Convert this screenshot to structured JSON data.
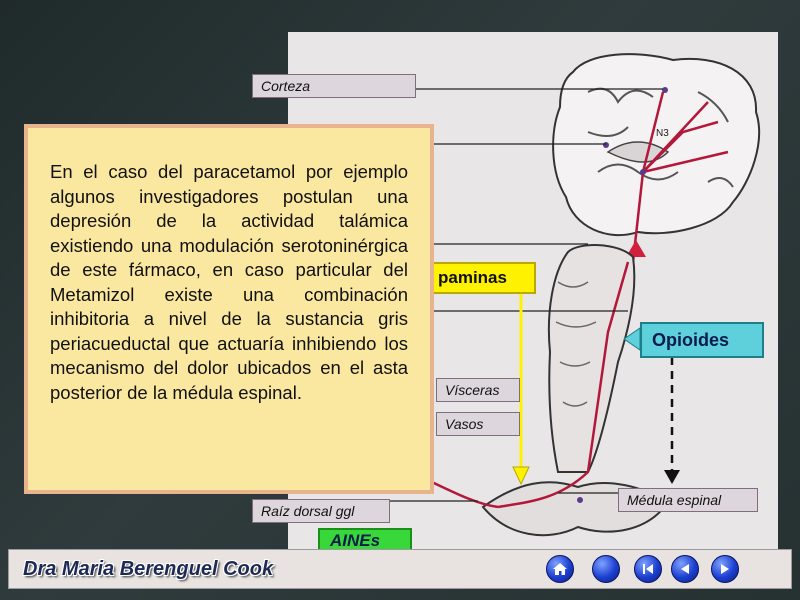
{
  "slide": {
    "paragraph": "En el caso del paracetamol por ejemplo algunos investigadores postulan una depresión de la actividad talámica existiendo una modulación serotoninérgica  de este fármaco, en caso particular del Metamizol existe una combinación inhibitoria a nivel de la sustancia gris periacueductal que actuaría inhibiendo los mecanismo del dolor ubicados en el asta posterior de la médula espinal."
  },
  "diagram": {
    "labels": {
      "corteza": "Corteza",
      "dopaminas": "paminas",
      "opioides": "Opioides",
      "visceras": "Vísceras",
      "vasos": "Vasos",
      "medula": "Médula espinal",
      "raiz": "Raíz dorsal  ggl",
      "aines": "AINEs"
    },
    "fiber_label": "N3"
  },
  "footer": {
    "author": "Dra Maria Berenguel Cook",
    "nav": [
      "home-icon",
      "circle-icon",
      "first-icon",
      "prev-icon",
      "next-icon"
    ]
  },
  "colors": {
    "yellow": "#fff200",
    "cyan": "#5ed0dc",
    "green": "#39d83a",
    "textbox": "#fbe8a0",
    "nav_blue": "#1c3fd1"
  }
}
